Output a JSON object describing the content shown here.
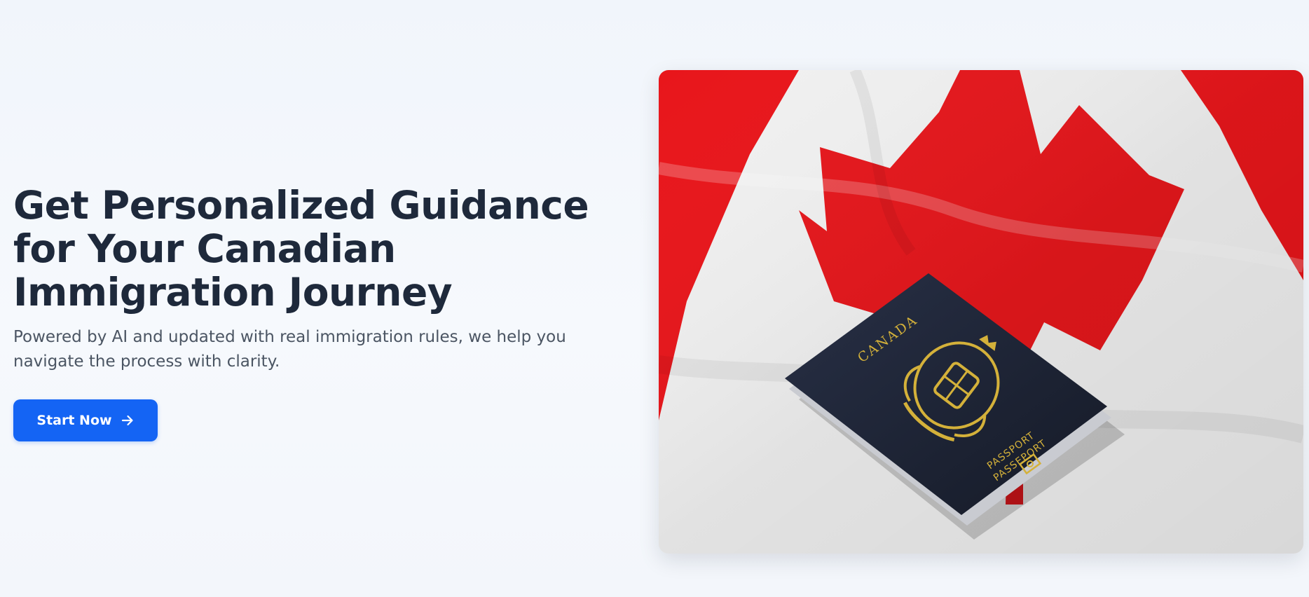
{
  "hero": {
    "headline": "Get Personalized Guidance for Your Canadian Immigration Journey",
    "subtext": "Powered by AI and updated with real immigration rules, we help you navigate the process with clarity.",
    "cta_label": "Start Now",
    "cta_icon": "arrow-right-icon",
    "image": {
      "passport_country": "CANADA",
      "passport_label_en": "PASSPORT",
      "passport_label_fr": "PASSEPORT"
    }
  },
  "colors": {
    "headline": "#1e293b",
    "subtext": "#4b5563",
    "cta_background": "#1464f4",
    "flag_red": "#e8161b",
    "passport_navy": "#1b2131",
    "passport_gold": "#d4b13a"
  }
}
